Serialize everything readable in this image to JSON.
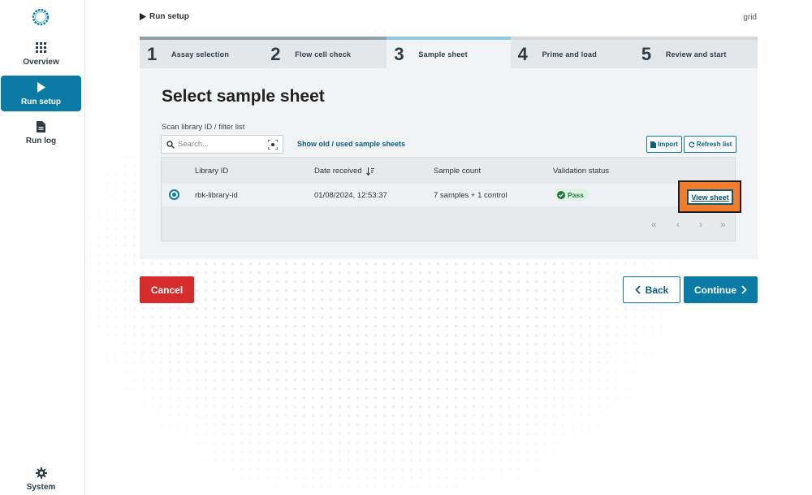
{
  "sidebar": {
    "items": [
      {
        "label": "Overview",
        "icon": "grid-icon"
      },
      {
        "label": "Run setup",
        "icon": "play-icon",
        "active": true
      },
      {
        "label": "Run log",
        "icon": "document-icon"
      }
    ],
    "system_label": "System"
  },
  "breadcrumb": "Run setup",
  "host": "grid",
  "steps": [
    {
      "num": "1",
      "label": "Assay selection",
      "state": "done"
    },
    {
      "num": "2",
      "label": "Flow cell check",
      "state": "done"
    },
    {
      "num": "3",
      "label": "Sample sheet",
      "state": "active"
    },
    {
      "num": "4",
      "label": "Prime and load",
      "state": "upcoming"
    },
    {
      "num": "5",
      "label": "Review and start",
      "state": "upcoming"
    }
  ],
  "page_title": "Select sample sheet",
  "filter": {
    "label": "Scan library ID / filter list",
    "placeholder": "Search...",
    "show_old_link": "Show old / used sample sheets"
  },
  "actions": {
    "import_label": "Import",
    "refresh_label": "Refresh list"
  },
  "table": {
    "columns": [
      "Library ID",
      "Date received",
      "Sample count",
      "Validation status"
    ],
    "rows": [
      {
        "library_id": "rbk-library-id",
        "date_received": "01/08/2024, 12:53:37",
        "sample_count": "7 samples + 1 control",
        "status": "Pass",
        "view_label": "View sheet"
      }
    ]
  },
  "buttons": {
    "cancel": "Cancel",
    "back": "Back",
    "continue": "Continue"
  },
  "colors": {
    "accent": "#0b7aa5",
    "cancel": "#d72c2c",
    "highlight": "#f07c2c",
    "pass": "#217a3c"
  }
}
